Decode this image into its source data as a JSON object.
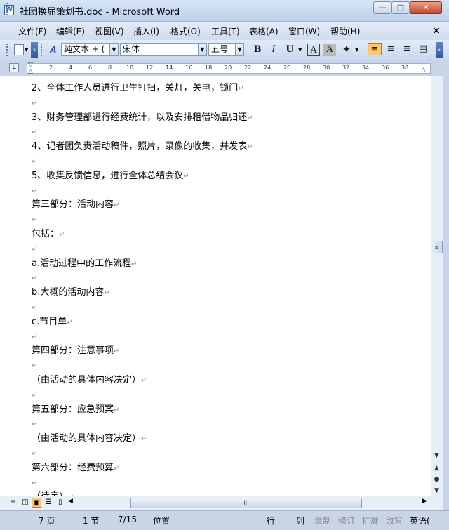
{
  "window": {
    "title": "社团换届策划书.doc - Microsoft Word",
    "icon_letter": "W",
    "min_label": "—",
    "max_label": "□",
    "close_label": "✕"
  },
  "menu": {
    "items": [
      "文件(F)",
      "编辑(E)",
      "视图(V)",
      "插入(I)",
      "格式(O)",
      "工具(T)",
      "表格(A)",
      "窗口(W)",
      "帮助(H)"
    ],
    "close_doc": "×"
  },
  "toolbar": {
    "style_value": "纯文本 + (",
    "font_value": "宋体",
    "size_value": "五号",
    "bold": "B",
    "italic": "I",
    "underline": "U",
    "font_color_a": "A",
    "char_shading_a": "A",
    "chevron": "»"
  },
  "ruler": {
    "corner": "L",
    "numbers": [
      "2",
      "4",
      "6",
      "8",
      "10",
      "12",
      "14",
      "16",
      "18",
      "20",
      "22",
      "24",
      "26",
      "28",
      "30",
      "32",
      "34",
      "36",
      "38"
    ]
  },
  "document": {
    "paragraph_mark": "↵",
    "lines": [
      "2、全体工作人员进行卫生打扫，关灯，关电，锁门",
      "",
      "3、财务管理部进行经费统计，以及安排租借物品归还",
      "",
      "4、记者团负责活动稿件，照片，录像的收集，并发表",
      "",
      "5、收集反馈信息，进行全体总结会议",
      "",
      "第三部分：活动内容",
      "",
      "包括：",
      "",
      "a.活动过程中的工作流程",
      "",
      "b.大概的活动内容",
      "",
      "c.节目单",
      "",
      "第四部分：注意事项",
      "",
      "（由活动的具体内容决定）",
      "",
      "第五部分：应急预案",
      "",
      "（由活动的具体内容决定）",
      "",
      "第六部分：经费预算",
      "",
      "（待定）"
    ]
  },
  "statusbar": {
    "page": "7 页",
    "section": "1 节",
    "page_of": "7/15",
    "position": "位置",
    "line": "行",
    "column": "列",
    "record": "录制",
    "revise": "修订",
    "extend": "扩展",
    "overtype": "改写",
    "language": "英语("
  }
}
